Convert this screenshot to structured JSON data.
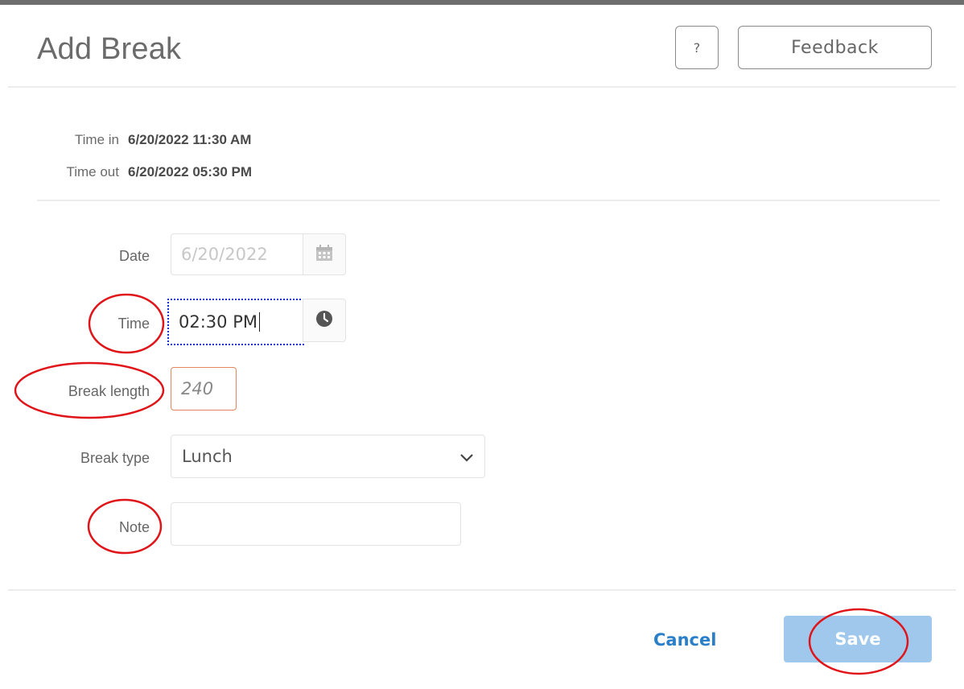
{
  "dialog": {
    "title": "Add Break",
    "help_label": "?",
    "feedback_label": "Feedback"
  },
  "info": {
    "time_in_label": "Time in",
    "time_in_value": "6/20/2022 11:30 AM",
    "time_out_label": "Time out",
    "time_out_value": "6/20/2022 05:30 PM"
  },
  "form": {
    "date_label": "Date",
    "date_value": "6/20/2022",
    "time_label": "Time",
    "time_value": "02:30 PM",
    "break_length_label": "Break length",
    "break_length_value": "240",
    "break_type_label": "Break type",
    "break_type_value": "Lunch",
    "note_label": "Note",
    "note_value": ""
  },
  "footer": {
    "cancel_label": "Cancel",
    "save_label": "Save"
  },
  "colors": {
    "accent": "#2a7fc9",
    "save_button": "#9fc8ec",
    "annotation": "#e0151a",
    "error_border": "#e2875e",
    "focus_border": "#1b2fd3"
  },
  "icons": [
    "calendar-icon",
    "clock-icon",
    "chevron-down-icon"
  ]
}
